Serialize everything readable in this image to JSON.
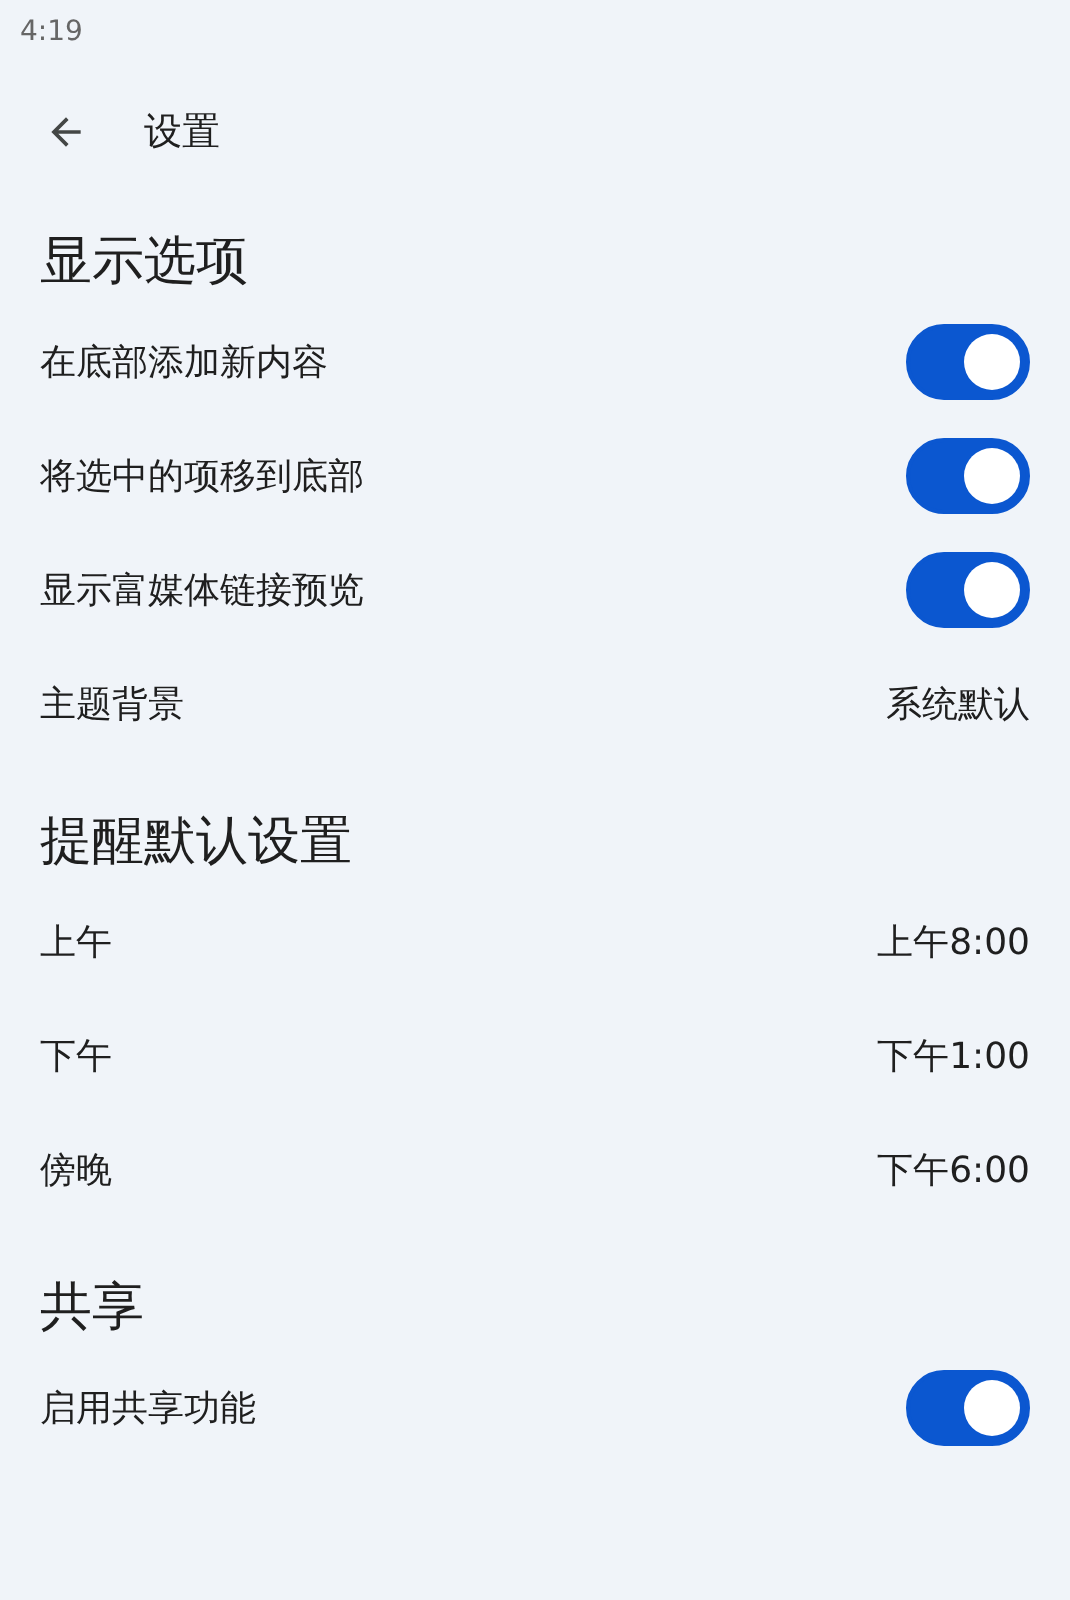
{
  "status_bar": {
    "time": "4:19"
  },
  "app_bar": {
    "title": "设置"
  },
  "sections": [
    {
      "title": "显示选项",
      "rows": [
        {
          "kind": "toggle",
          "label": "在底部添加新内容",
          "on": true
        },
        {
          "kind": "toggle",
          "label": "将选中的项移到底部",
          "on": true
        },
        {
          "kind": "toggle",
          "label": "显示富媒体链接预览",
          "on": true
        },
        {
          "kind": "value",
          "label": "主题背景",
          "value": "系统默认"
        }
      ]
    },
    {
      "title": "提醒默认设置",
      "rows": [
        {
          "kind": "value",
          "label": "上午",
          "value": "上午8:00"
        },
        {
          "kind": "value",
          "label": "下午",
          "value": "下午1:00"
        },
        {
          "kind": "value",
          "label": "傍晚",
          "value": "下午6:00"
        }
      ]
    },
    {
      "title": "共享",
      "rows": [
        {
          "kind": "toggle",
          "label": "启用共享功能",
          "on": true
        }
      ]
    }
  ]
}
